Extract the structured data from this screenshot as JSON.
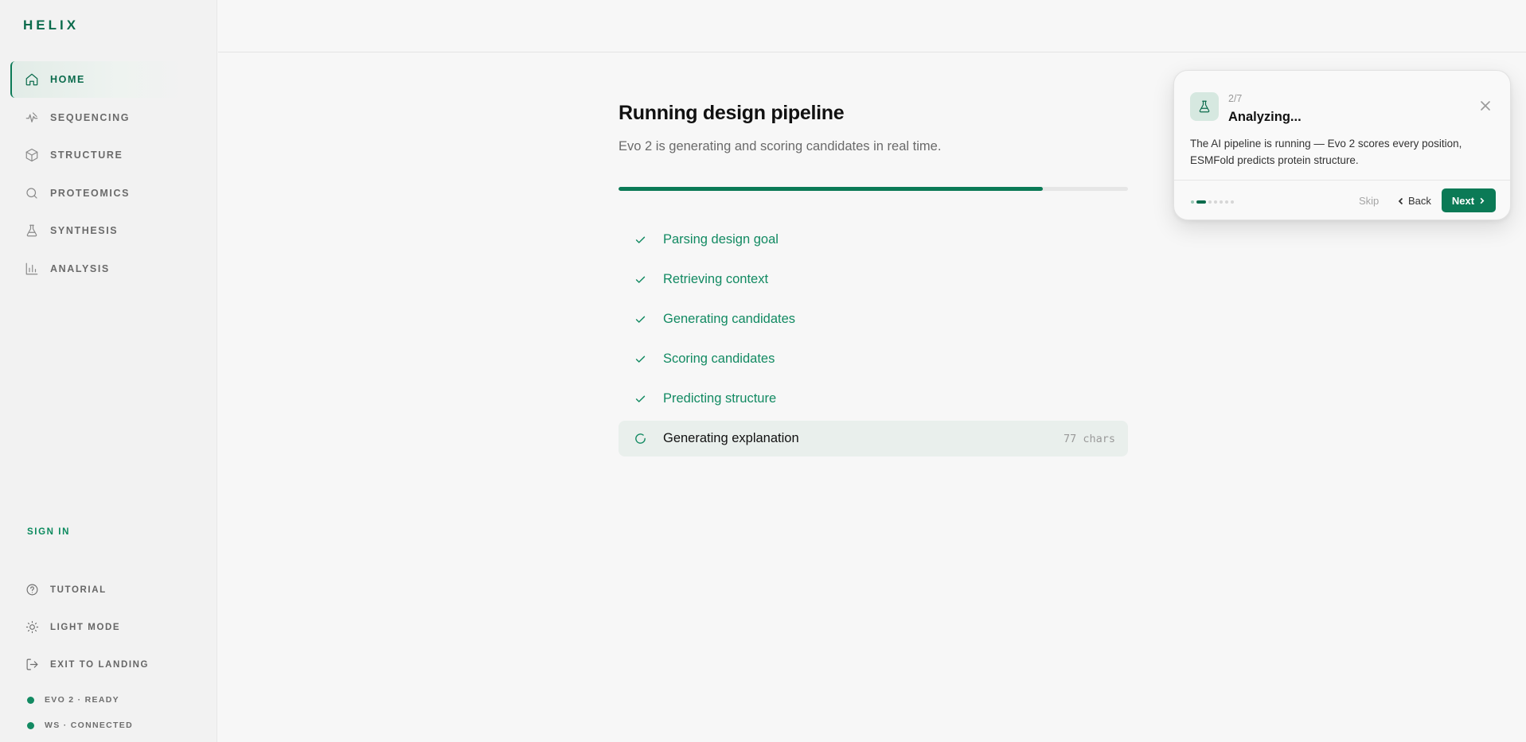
{
  "app": {
    "logo": "HELIX"
  },
  "sidebar": {
    "items": [
      {
        "label": "HOME",
        "icon": "home-icon",
        "active": true
      },
      {
        "label": "SEQUENCING",
        "icon": "sequencing-icon",
        "active": false
      },
      {
        "label": "STRUCTURE",
        "icon": "cube-icon",
        "active": false
      },
      {
        "label": "PROTEOMICS",
        "icon": "search-icon",
        "active": false
      },
      {
        "label": "SYNTHESIS",
        "icon": "flask-icon",
        "active": false
      },
      {
        "label": "ANALYSIS",
        "icon": "bar-chart-icon",
        "active": false
      }
    ],
    "sign_in": "SIGN IN",
    "bottom_items": [
      {
        "label": "TUTORIAL",
        "icon": "help-circle-icon"
      },
      {
        "label": "LIGHT MODE",
        "icon": "sun-icon"
      },
      {
        "label": "EXIT TO LANDING",
        "icon": "log-out-icon"
      }
    ],
    "status": [
      {
        "label": "EVO 2 · READY",
        "color": "#138a62"
      },
      {
        "label": "WS · CONNECTED",
        "color": "#138a62"
      }
    ]
  },
  "main": {
    "title": "Running design pipeline",
    "subtitle": "Evo 2 is generating and scoring candidates in real time.",
    "progress": 0.833,
    "steps": [
      {
        "label": "Parsing design goal",
        "state": "done"
      },
      {
        "label": "Retrieving context",
        "state": "done"
      },
      {
        "label": "Generating candidates",
        "state": "done"
      },
      {
        "label": "Scoring candidates",
        "state": "done"
      },
      {
        "label": "Predicting structure",
        "state": "done"
      },
      {
        "label": "Generating explanation",
        "state": "running",
        "meta": "77 chars"
      }
    ]
  },
  "tour": {
    "step": "2/7",
    "current": 2,
    "total": 7,
    "title": "Analyzing...",
    "body": "The AI pipeline is running — Evo 2 scores every position, ESMFold predicts protein structure.",
    "skip_label": "Skip",
    "back_label": "Back",
    "next_label": "Next"
  },
  "colors": {
    "accent": "#0b7a56",
    "success": "#128a62"
  }
}
